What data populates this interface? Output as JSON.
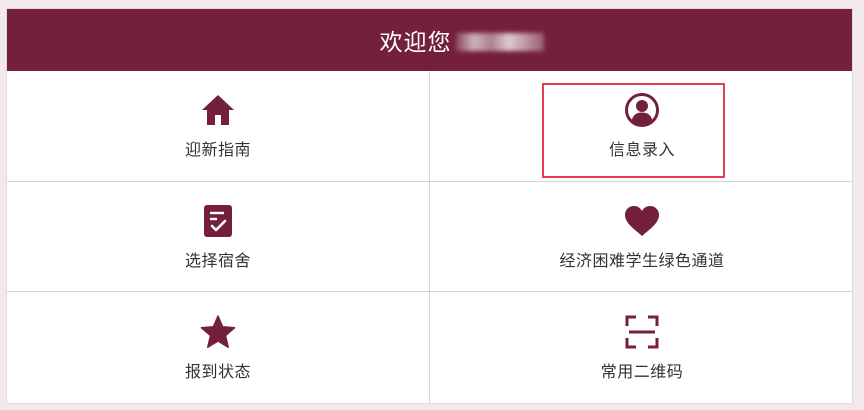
{
  "header": {
    "title": "欢迎您"
  },
  "menu": [
    {
      "label": "迎新指南",
      "icon": "home-icon"
    },
    {
      "label": "信息录入",
      "icon": "user-circle-icon"
    },
    {
      "label": "选择宿舍",
      "icon": "clipboard-check-icon"
    },
    {
      "label": "经济困难学生绿色通道",
      "icon": "heart-icon"
    },
    {
      "label": "报到状态",
      "icon": "star-icon"
    },
    {
      "label": "常用二维码",
      "icon": "qr-scan-icon"
    }
  ],
  "colors": {
    "brand": "#74203d",
    "highlight": "#e0424a"
  }
}
